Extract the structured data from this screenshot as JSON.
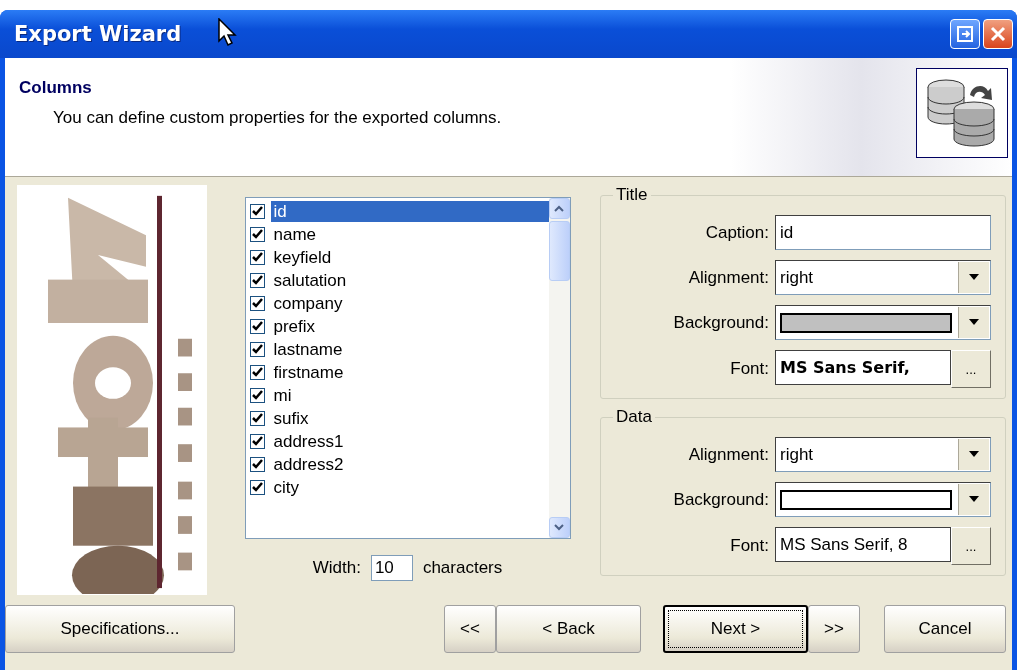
{
  "window": {
    "title": "Export Wizard"
  },
  "header": {
    "title": "Columns",
    "description": "You can define custom properties for the exported columns."
  },
  "column_list": {
    "items": [
      {
        "label": "id",
        "checked": true,
        "selected": true
      },
      {
        "label": "name",
        "checked": true,
        "selected": false
      },
      {
        "label": "keyfield",
        "checked": true,
        "selected": false
      },
      {
        "label": "salutation",
        "checked": true,
        "selected": false
      },
      {
        "label": "company",
        "checked": true,
        "selected": false
      },
      {
        "label": "prefix",
        "checked": true,
        "selected": false
      },
      {
        "label": "lastname",
        "checked": true,
        "selected": false
      },
      {
        "label": "firstname",
        "checked": true,
        "selected": false
      },
      {
        "label": "mi",
        "checked": true,
        "selected": false
      },
      {
        "label": "sufix",
        "checked": true,
        "selected": false
      },
      {
        "label": "address1",
        "checked": true,
        "selected": false
      },
      {
        "label": "address2",
        "checked": true,
        "selected": false
      },
      {
        "label": "city",
        "checked": true,
        "selected": false
      }
    ]
  },
  "width": {
    "label": "Width:",
    "value": "10",
    "unit": "characters"
  },
  "groups": [
    {
      "legend": "Title",
      "fields": [
        {
          "kind": "text",
          "label": "Caption:",
          "value": "id"
        },
        {
          "kind": "dropdown",
          "label": "Alignment:",
          "value": "right"
        },
        {
          "kind": "color",
          "label": "Background:",
          "color": "#c0c0c0"
        },
        {
          "kind": "font",
          "label": "Font:",
          "value": "MS Sans Serif,",
          "bold": true
        }
      ]
    },
    {
      "legend": "Data",
      "fields": [
        {
          "kind": "dropdown",
          "label": "Alignment:",
          "value": "right"
        },
        {
          "kind": "color",
          "label": "Background:",
          "color": "#ffffff"
        },
        {
          "kind": "font",
          "label": "Font:",
          "value": "MS Sans Serif, 8",
          "bold": false
        }
      ]
    }
  ],
  "font_button": "...",
  "buttons": [
    {
      "label": "Specifications...",
      "kind": "left",
      "focused": false
    },
    {
      "label": "<<",
      "kind": "nav",
      "focused": false
    },
    {
      "label": "< Back",
      "kind": "nav",
      "focused": false
    },
    {
      "label": "Next >",
      "kind": "nav",
      "focused": true
    },
    {
      "label": ">>",
      "kind": "nav",
      "focused": false
    },
    {
      "label": "Cancel",
      "kind": "cancel",
      "focused": false
    }
  ]
}
